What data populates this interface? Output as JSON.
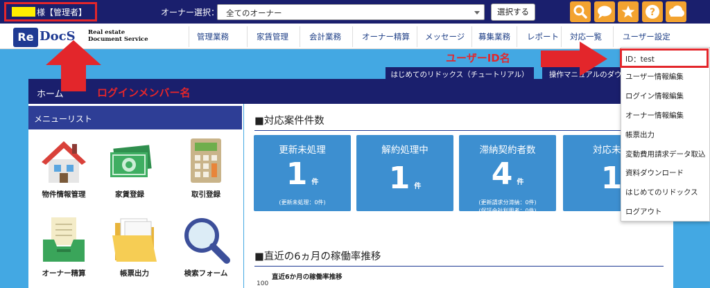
{
  "topbar": {
    "user_label": "様【管理者】",
    "owner_label": "オーナー選択：",
    "owner_select_value": "全てのオーナー",
    "select_button": "選択する",
    "tools": [
      "search-icon",
      "chat-icon",
      "star-icon",
      "help-icon",
      "cloud-icon"
    ],
    "tool_color": "#f3a330"
  },
  "logo": {
    "re": "Re",
    "docs": "DocS",
    "subtitle_line1": "Real estate",
    "subtitle_line2": "Document Service"
  },
  "nav": {
    "items": [
      "管理業務",
      "家賃管理",
      "会計業務",
      "オーナー精算",
      "メッセージ",
      "募集業務",
      "レポート",
      "対応一覧",
      "ユーザー設定"
    ]
  },
  "annotations": {
    "login_member": "ログインメンバー名",
    "user_id": "ユーザーID名"
  },
  "buttons": {
    "tutorial": "はじめてのリドックス（チュートリアル）",
    "manual": "操作マニュアルのダウ"
  },
  "home": {
    "title": "ホーム"
  },
  "sidebar": {
    "title": "メニューリスト",
    "items": [
      {
        "label": "物件情報管理",
        "icon": "house-icon"
      },
      {
        "label": "家賃登録",
        "icon": "money-icon"
      },
      {
        "label": "取引登録",
        "icon": "calculator-icon"
      },
      {
        "label": "オーナー精算",
        "icon": "inbox-tray-icon"
      },
      {
        "label": "帳票出力",
        "icon": "folder-icon"
      },
      {
        "label": "検索フォーム",
        "icon": "magnifier-icon"
      }
    ]
  },
  "cases": {
    "title": "■対応案件件数",
    "cards": [
      {
        "title": "更新未処理",
        "count": "1",
        "unit": "件",
        "notes": [
          "(更新未処理：0件)"
        ]
      },
      {
        "title": "解約処理中",
        "count": "1",
        "unit": "件",
        "notes": []
      },
      {
        "title": "滞納契約者数",
        "count": "4",
        "unit": "件",
        "notes": [
          "(更新請求分滞納：0件)",
          "(保証会社利用者：0件)"
        ]
      },
      {
        "title": "対応未完",
        "count": "1",
        "unit": "",
        "notes": []
      }
    ]
  },
  "occupancy": {
    "title": "■直近の6ヵ月の稼働率推移",
    "chart_title": "直近6か月の稼働率推移",
    "axis_top": "100"
  },
  "dropdown": {
    "items": [
      "ID：test",
      "ユーザー情報編集",
      "ログイン情報編集",
      "オーナー情報編集",
      "帳票出力",
      "変動費用請求データ取込",
      "資料ダウンロード",
      "はじめてのリドックス",
      "ログアウト"
    ]
  },
  "colors": {
    "navy": "#1a1f6d",
    "accent_blue": "#3d8fd0",
    "annotation_red": "#e3262b",
    "background": "#43a8e3"
  }
}
